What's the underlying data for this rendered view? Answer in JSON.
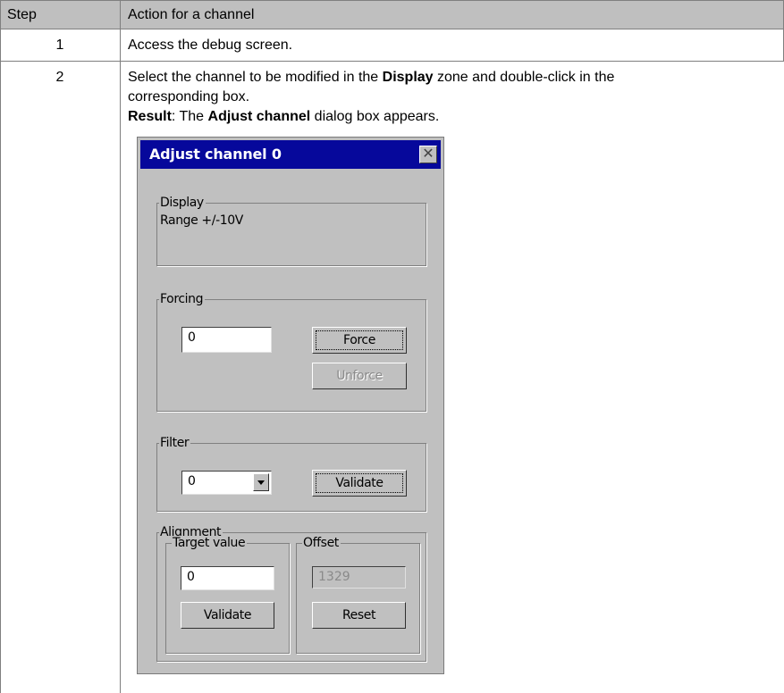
{
  "table": {
    "headers": {
      "step": "Step",
      "action": "Action for a channel"
    },
    "rows": [
      {
        "step": "1",
        "line1": "Access the debug screen."
      },
      {
        "step": "2",
        "line1_pre": "Select the channel to be modified in the ",
        "line1_bold": "Display",
        "line1_post": " zone and double-click in the",
        "line2": "corresponding box.",
        "result_bold": "Result",
        "result_pre": ": The ",
        "result_bold2": "Adjust channel",
        "result_post": " dialog box appears."
      }
    ]
  },
  "dialog": {
    "title": "Adjust channel 0",
    "close_glyph": "✕",
    "display": {
      "legend": "Display",
      "value": "Range +/-10V"
    },
    "forcing": {
      "legend": "Forcing",
      "input_value": "0",
      "force_label": "Force",
      "unforce_label": "Unforce"
    },
    "filter": {
      "legend": "Filter",
      "selected": "0",
      "validate_label": "Validate"
    },
    "alignment": {
      "legend": "Alignment",
      "target": {
        "legend": "Target value",
        "input_value": "0",
        "validate_label": "Validate"
      },
      "offset": {
        "legend": "Offset",
        "value": "1329",
        "reset_label": "Reset"
      }
    }
  }
}
